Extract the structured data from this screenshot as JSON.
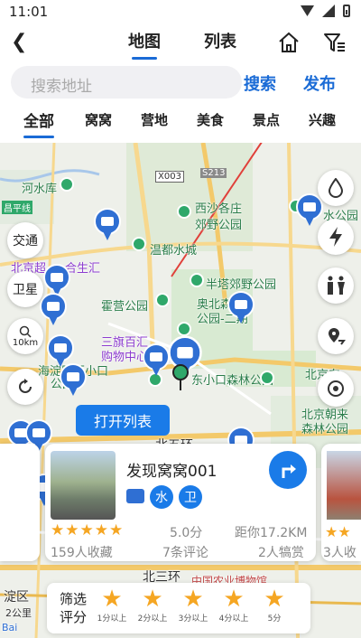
{
  "status": {
    "time": "11:01"
  },
  "nav": {
    "tab_map": "地图",
    "tab_list": "列表"
  },
  "search": {
    "placeholder": "搜索地址",
    "search_label": "搜索",
    "publish_label": "发布"
  },
  "categories": [
    "全部",
    "窝窝",
    "营地",
    "美食",
    "景点",
    "兴趣"
  ],
  "map": {
    "road_labels": [
      "X003",
      "S213"
    ],
    "labels": {
      "l1": "河水库",
      "l2": "昌平线",
      "l3": "西沙各庄",
      "l4": "郊野公园",
      "l5": "水公园",
      "l6": "温都水城",
      "l7": "北京超",
      "l8": "合生汇",
      "l9": "半塔郊野公园",
      "l10": "霍营公园",
      "l11": "奥北森林",
      "l12": "公园-二期",
      "l13": "三旗百汇",
      "l14": "购物中心",
      "l15": "海淀区西小口",
      "l16": "公园",
      "l17": "东小口森林公园",
      "l18": "北京东",
      "l19": "北京朝来",
      "l20": "森林公园",
      "l21": "北五环",
      "l22": "北三环",
      "l23": "中国农业博物馆",
      "l24": "淀区",
      "l25": "2公里",
      "l26": "Bai"
    },
    "controls": {
      "traffic": "交通",
      "satellite": "卫星",
      "scale": "10km"
    },
    "open_list_label": "打开列表"
  },
  "card": {
    "title": "发现窝窝001",
    "tag1": "水",
    "tag2": "卫",
    "stars": "★★★★★",
    "score": "5.0分",
    "distance": "距你17.2KM",
    "favorites": "159人收藏",
    "comments": "7条评论",
    "visits": "2人犒赏"
  },
  "peek": {
    "right_text": "3人收"
  },
  "filter": {
    "label": "筛选评分",
    "options": [
      "1分以上",
      "2分以上",
      "3分以上",
      "4分以上",
      "5分"
    ]
  },
  "colors": {
    "accent": "#1a6bd6",
    "star": "#f5a623",
    "pin": "#2f6fd3",
    "poi": "#2fa86a"
  }
}
